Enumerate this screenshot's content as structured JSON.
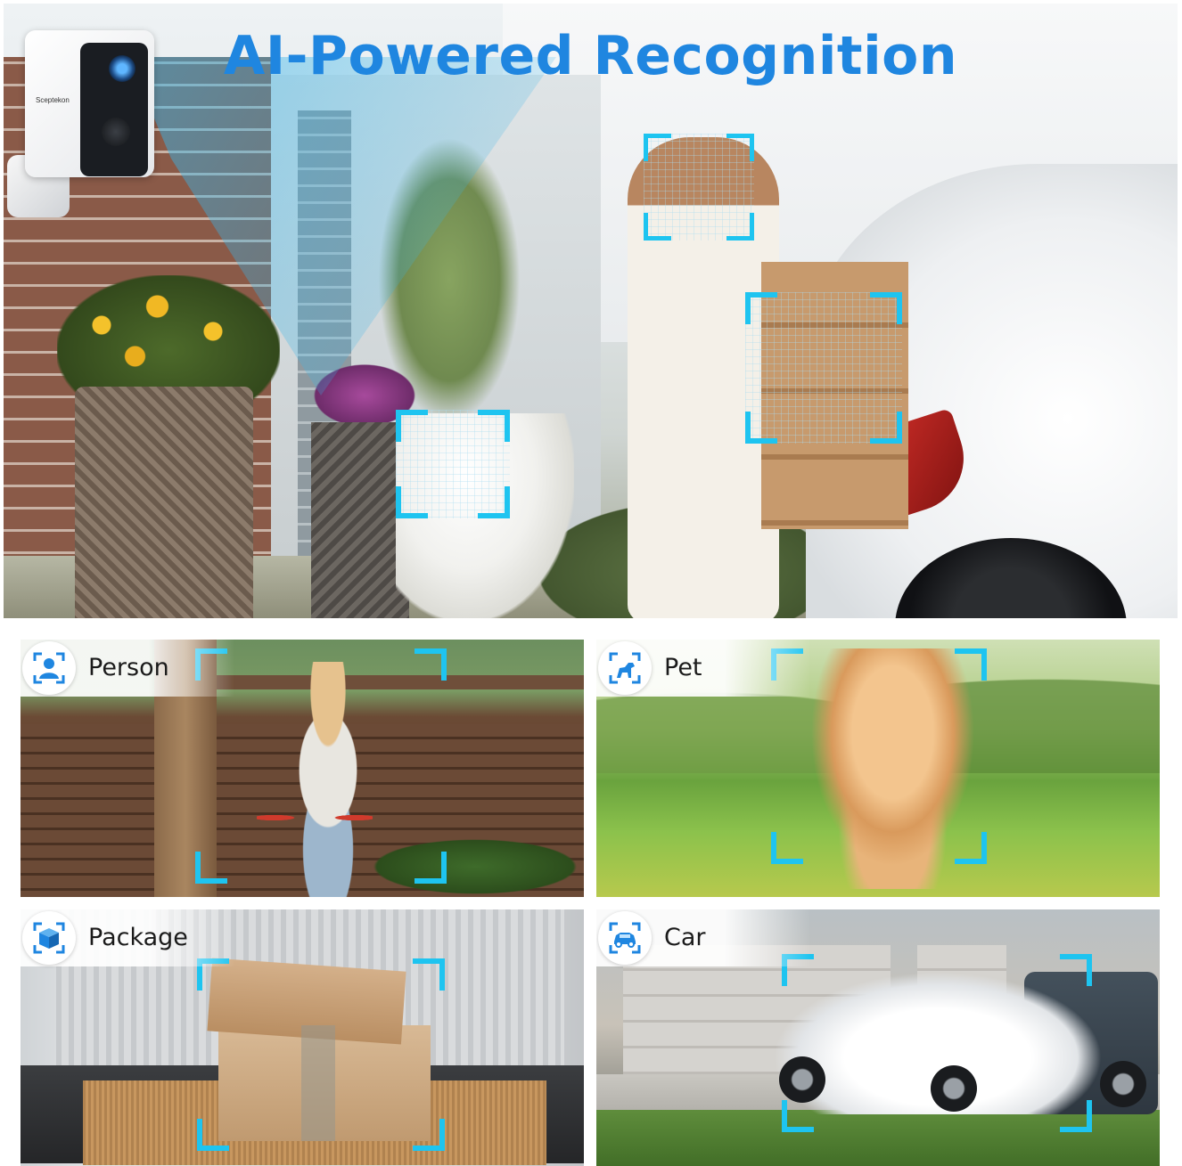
{
  "hero": {
    "title": "AI-Powered Recognition",
    "camera_brand": "Sceptekon"
  },
  "tiles": [
    {
      "id": "person",
      "label": "Person",
      "icon": "person-icon"
    },
    {
      "id": "pet",
      "label": "Pet",
      "icon": "pet-icon"
    },
    {
      "id": "package",
      "label": "Package",
      "icon": "package-icon"
    },
    {
      "id": "car",
      "label": "Car",
      "icon": "car-icon"
    }
  ],
  "colors": {
    "title_blue": "#1f86e0",
    "detection_cyan": "#1ec4f0"
  }
}
